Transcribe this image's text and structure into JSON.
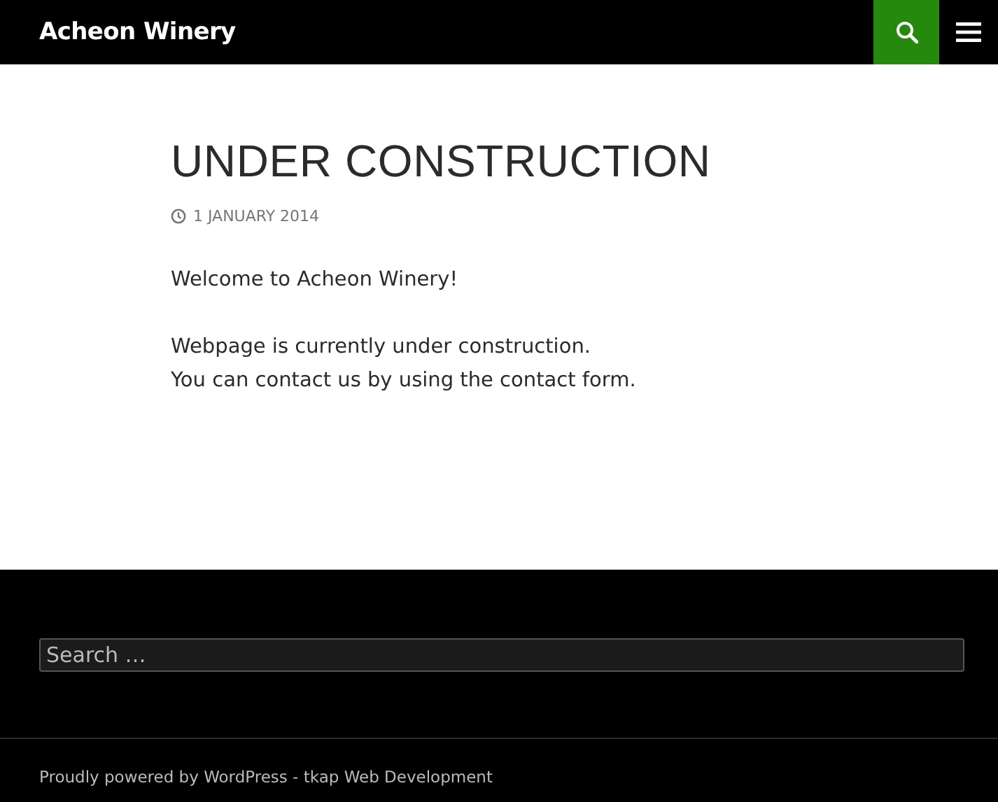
{
  "header": {
    "site_title": "Acheon Winery"
  },
  "post": {
    "title": "UNDER CONSTRUCTION",
    "date": "1 JANUARY 2014",
    "paragraphs": [
      [
        "Welcome to Acheon Winery!"
      ],
      [
        "Webpage is currently under construction.",
        "You can contact us by using the contact form."
      ]
    ]
  },
  "footer": {
    "search": {
      "placeholder": "Search …"
    },
    "credit": "Proudly powered by WordPress - tkap Web Development"
  }
}
